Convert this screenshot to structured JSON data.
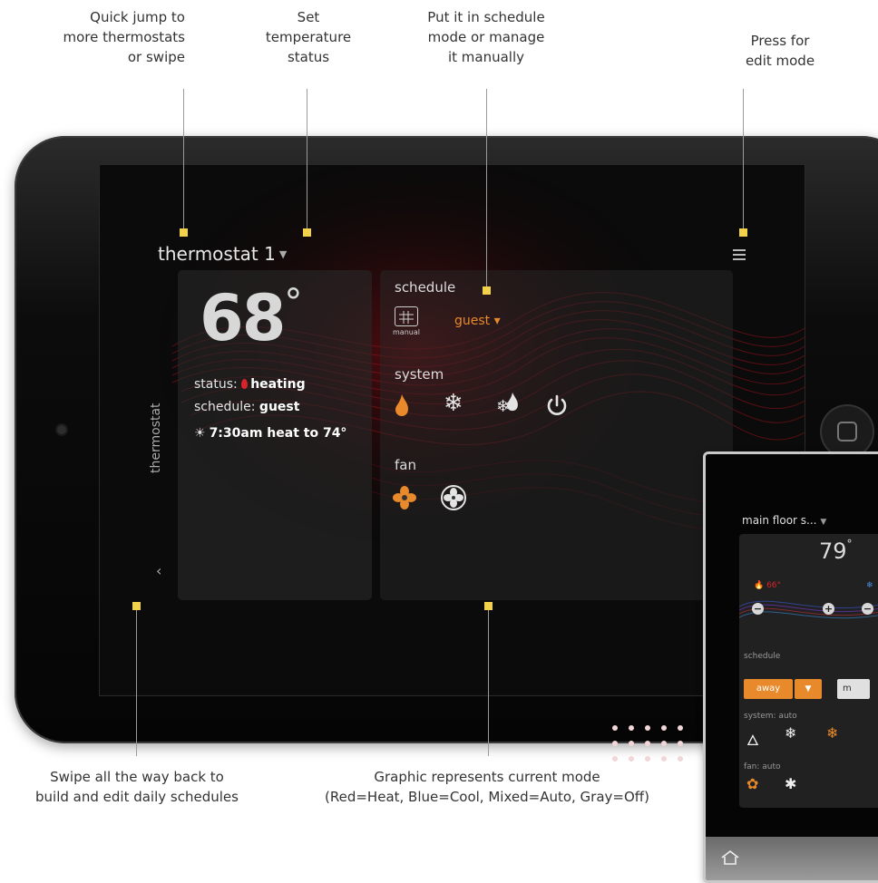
{
  "callouts": {
    "quick_jump": "Quick jump to\nmore thermostats\nor swipe",
    "set_temp": "Set\ntemperature\nstatus",
    "schedule_mode": "Put it in schedule\nmode or manage\nit manually",
    "edit_mode": "Press for\nedit mode",
    "swipe_back": "Swipe all the way back to\nbuild and edit daily schedules",
    "graphic_mode": "Graphic represents current mode\n(Red=Heat, Blue=Cool, Mixed=Auto, Gray=Off)"
  },
  "tablet": {
    "title": "thermostat 1",
    "temperature": "68",
    "status_label": "status:",
    "status_value": "heating",
    "schedule_label": "schedule:",
    "schedule_value": "guest",
    "next_event": "7:30am heat to 74°",
    "side_tab": "thermostat",
    "schedule_heading": "schedule",
    "manual_label": "manual",
    "schedule_selected": "guest",
    "system_heading": "system",
    "fan_heading": "fan",
    "system_icons": [
      "flame-icon",
      "snowflake-icon",
      "auto-icon",
      "power-icon"
    ],
    "fan_icons": [
      "fan-on-icon",
      "fan-auto-icon"
    ]
  },
  "phone": {
    "title": "main floor s...",
    "temperature": "79",
    "heat_setpoint": "66°",
    "schedule_label": "schedule",
    "schedule_value": "away",
    "manual_partial": "m",
    "system_label": "system: auto",
    "fan_label": "fan: auto"
  },
  "colors": {
    "accent_orange": "#e8892b",
    "heat_red": "#d8232a",
    "cool_blue": "#4a8fe0",
    "marker_yellow": "#f2d24a"
  }
}
